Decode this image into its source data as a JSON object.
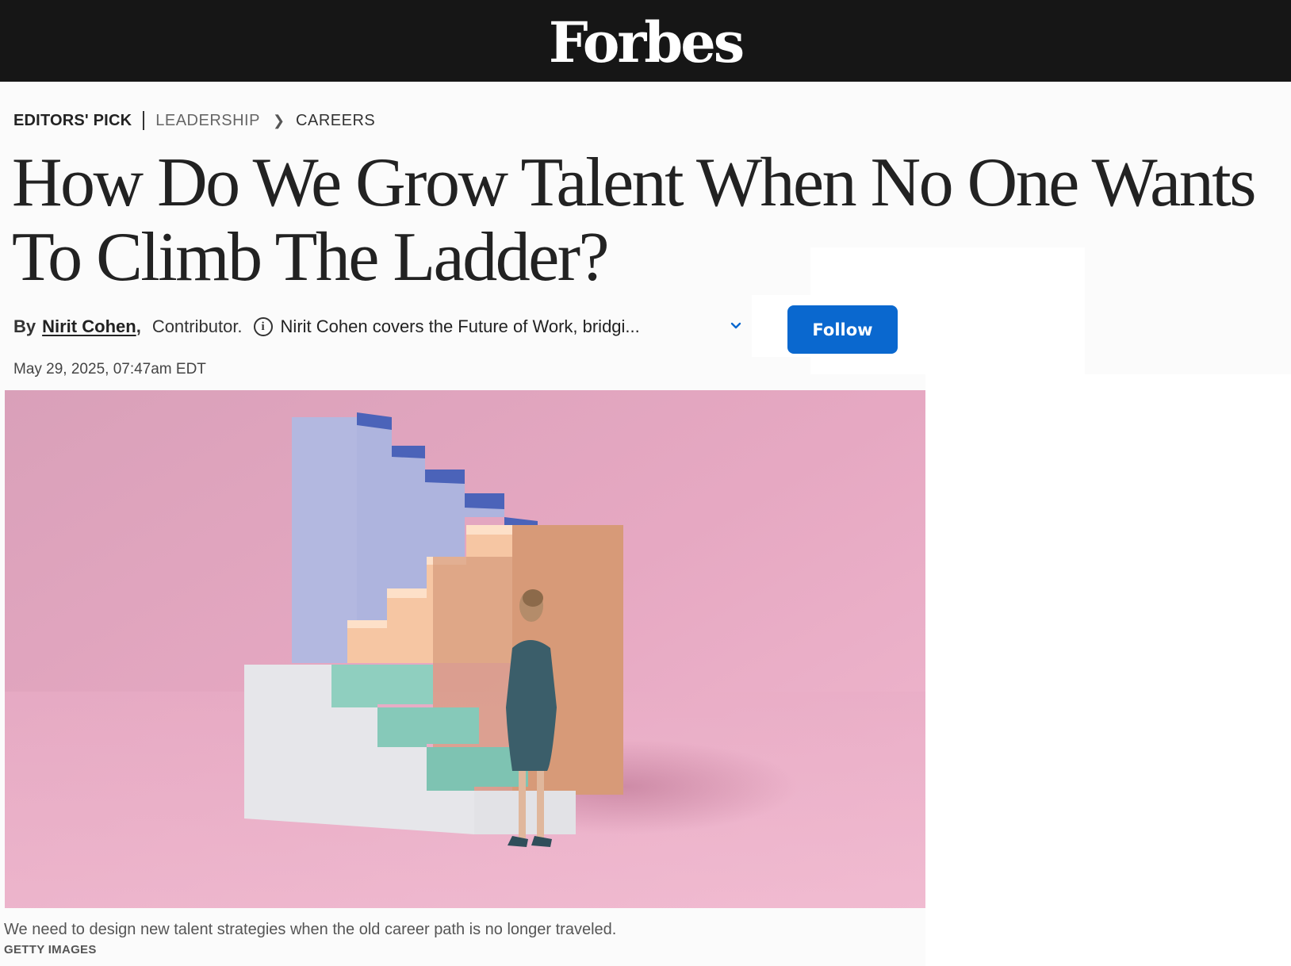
{
  "brand": {
    "logo_text": "Forbes"
  },
  "breadcrumb": {
    "editors_pick": "EDITORS' PICK",
    "section": "LEADERSHIP",
    "subsection": "CAREERS"
  },
  "article": {
    "headline": "How Do We Grow Talent When No One Wants To Climb The Ladder?",
    "timestamp": "May 29, 2025, 07:47am EDT"
  },
  "byline": {
    "by_label": "By",
    "author": "Nirit Cohen",
    "comma": ",",
    "role": "Contributor.",
    "bio_preview": "Nirit Cohen covers the Future of Work, bridgi...",
    "follow_label": "Follow"
  },
  "image": {
    "caption": "We need to design new talent strategies when the old career path is no longer traveled.",
    "credit": "GETTY IMAGES"
  },
  "colors": {
    "masthead_bg": "#161616",
    "follow_button": "#0a68cf",
    "image_background": "#e7a9c0"
  },
  "icons": [
    "info-icon",
    "chevron-down-icon"
  ]
}
